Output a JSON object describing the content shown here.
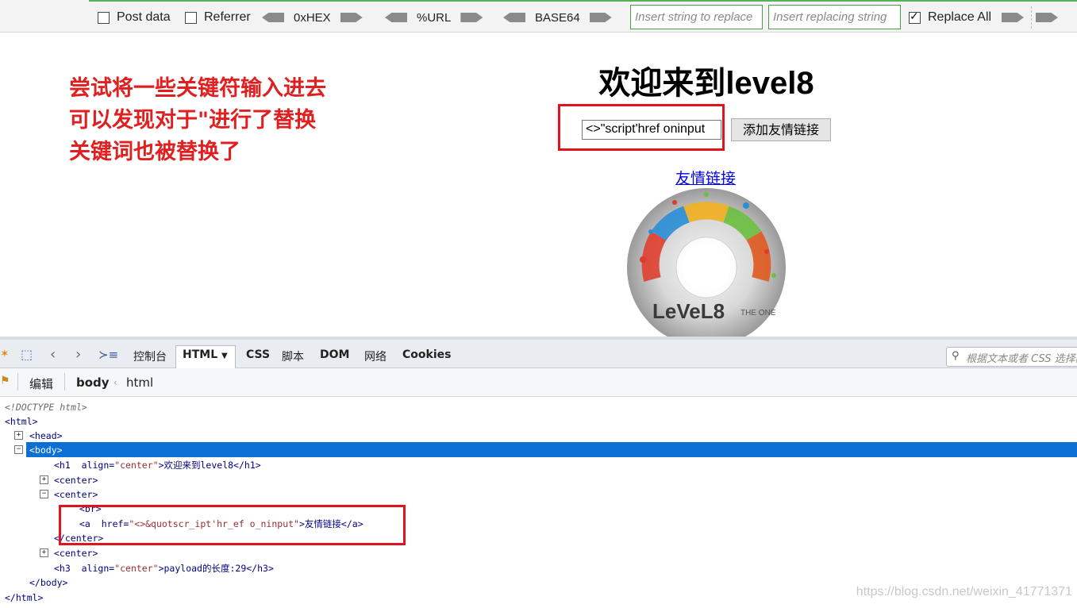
{
  "toolbar": {
    "post_data": "Post data",
    "referrer": "Referrer",
    "hex": "0xHEX",
    "url": "%URL",
    "base64": "BASE64",
    "search_placeholder": "Insert string to replace",
    "replace_placeholder": "Insert replacing string",
    "replace_all": "Replace All",
    "replace_all_checked": true
  },
  "annotation": {
    "lines": [
      "尝试将一些关键符输入进去",
      "可以发现对于\"进行了替换",
      "关键词也被替换了"
    ]
  },
  "page": {
    "title": "欢迎来到level8",
    "keyword_value": "<>\"script'href oninput",
    "add_button": "添加友情链接",
    "friend_link": "友情链接",
    "disc_label": "LeVeL8",
    "disc_label_small": "THE ONE"
  },
  "devtools": {
    "tabs": [
      "控制台",
      "HTML",
      "CSS",
      "脚本",
      "DOM",
      "网络",
      "Cookies"
    ],
    "active_tab": "HTML",
    "search_placeholder": "根据文本或者 CSS 选择器",
    "edit": "编辑",
    "crumbs": [
      "body",
      "html"
    ],
    "code": {
      "doctype": "<!DOCTYPE html>",
      "html_open": "<html>",
      "head": "<head>",
      "body_open": "<body>",
      "h1_tag": "<h1",
      "h1_attr": "align=",
      "h1_val": "\"center\"",
      "h1_text": ">欢迎来到level8",
      "h1_close": "</h1>",
      "center1": "<center>",
      "center2": "<center>",
      "br": "<br>",
      "a_tag": "<a",
      "a_attr": "href=",
      "a_val": "\"<>&quotscr_ipt'hr_ef o_ninput\"",
      "a_text": ">友情链接",
      "a_close": "</a>",
      "center_close": "</center>",
      "center3": "<center>",
      "h3_tag": "<h3",
      "h3_attr": "align=",
      "h3_val": "\"center\"",
      "h3_text": ">payload的长度:29",
      "h3_close": "</h3>",
      "body_close": "</body>",
      "html_close": "</html>"
    }
  },
  "watermark": "https://blog.csdn.net/weixin_41771371",
  "colors": {
    "annotation_red": "#e02020",
    "highlight_box": "#e0141e",
    "selection_blue": "#0b6fd6",
    "link_blue": "#0000ee"
  }
}
